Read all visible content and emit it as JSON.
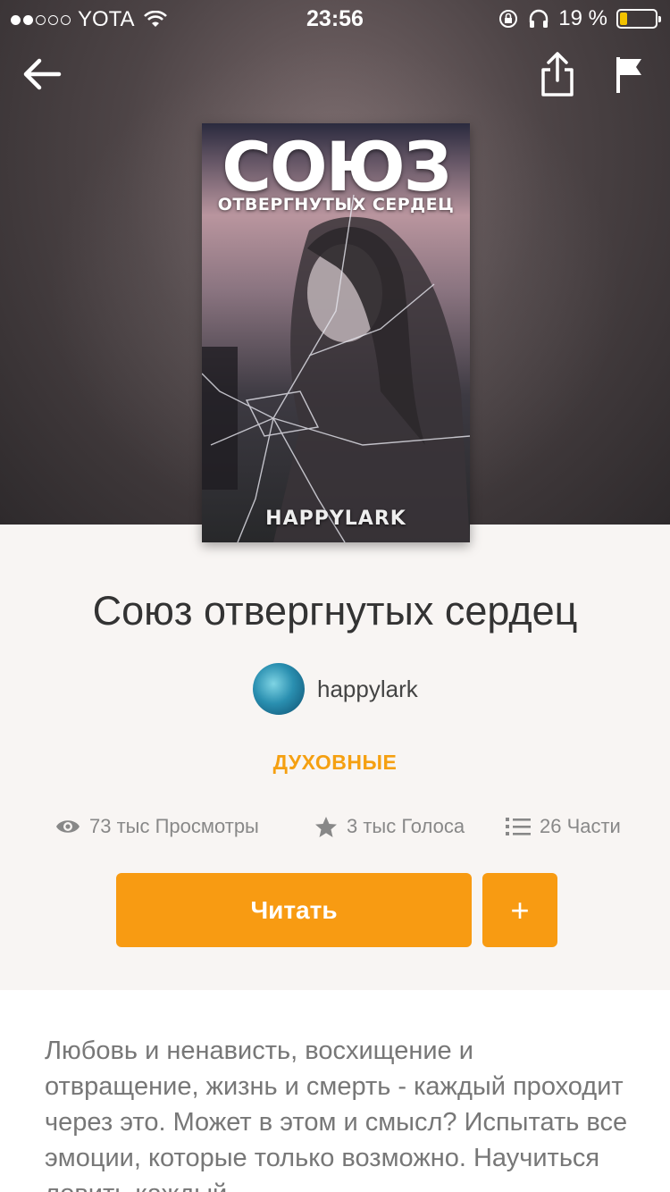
{
  "status_bar": {
    "carrier": "YOTA",
    "time": "23:56",
    "battery": "19 %"
  },
  "cover": {
    "title": "СОЮЗ",
    "subtitle": "ОТВЕРГНУТЫХ СЕРДЕЦ",
    "author": "HAPPYLARK"
  },
  "book": {
    "title": "Союз отвергнутых сердец",
    "author": "happylark",
    "genre": "ДУХОВНЫЕ"
  },
  "stats": {
    "views": "73 тыс Просмотры",
    "votes": "3 тыс Голоса",
    "parts": "26 Части"
  },
  "actions": {
    "read_label": "Читать",
    "add_label": "+"
  },
  "description": "Любовь и ненависть, восхищение и отвращение, жизнь и смерть - каждый проходит через это. Может в этом и смысл? Испытать все эмоции, которые только возможно. Научиться ловить каждый",
  "colors": {
    "accent": "#f89b12",
    "genre": "#f5a011"
  }
}
